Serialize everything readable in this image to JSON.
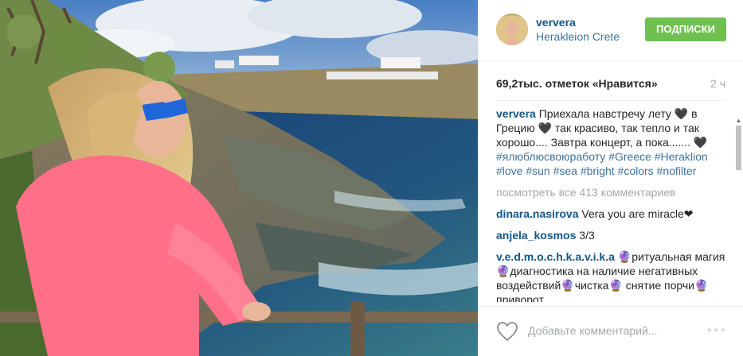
{
  "header": {
    "username": "ververa",
    "location": "Herakleion Crete",
    "follow_label": "ПОДПИСКИ"
  },
  "stats": {
    "likes": "69,2тыс. отметок «Нравится»",
    "time": "2 ч"
  },
  "caption": {
    "user": "ververa",
    "text": "Приехала навстречу лету 🖤 в Грецию 🖤 так красиво, так тепло и так хорошо.... Завтра концерт, а пока....... 🖤",
    "tags": "#ялюблюсвоюработу #Greece #Heraklion #love #sun #sea #bright #colors #nofilter"
  },
  "view_all": "посмотреть все 413 комментариев",
  "comments": [
    {
      "user": "dinara.nasirova",
      "text": "Vera you are miracle❤"
    },
    {
      "user": "anjela_kosmos",
      "text": "3/3"
    },
    {
      "user": "v.e.d.m.o.c.h.k.a.v.i.k.a",
      "text": "🔮ритуальная магия🔮диагностика на наличие негативных воздействий🔮чистка🔮 снятие порчи🔮 приворот"
    }
  ],
  "footer": {
    "add_comment_placeholder": "Добавьте комментарий...",
    "more_options": "∘∘∘"
  },
  "colors": {
    "follow_button": "#70c050",
    "username": "#125688",
    "hashtag": "#3f729b"
  }
}
